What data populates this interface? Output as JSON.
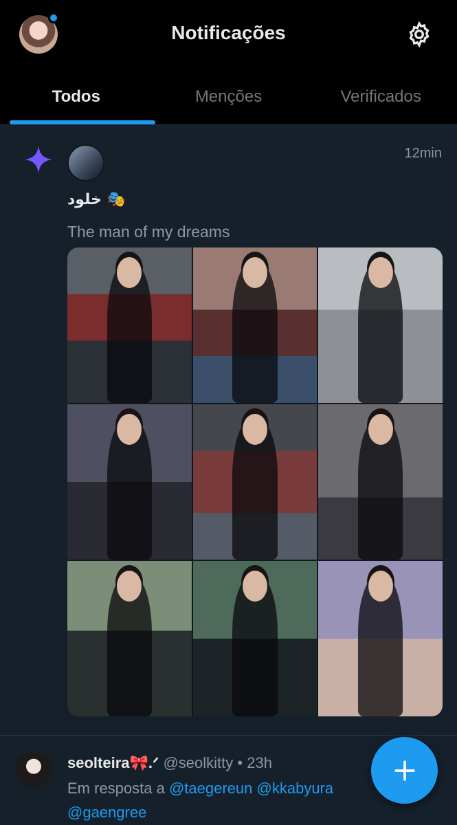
{
  "header": {
    "title": "Notificações"
  },
  "tabs": [
    {
      "label": "Todos",
      "active": true
    },
    {
      "label": "Menções",
      "active": false
    },
    {
      "label": "Verificados",
      "active": false
    }
  ],
  "notification": {
    "time": "12min",
    "user_name": "خلود 🎭",
    "post_text": "The man of my dreams",
    "image_count": 9
  },
  "reply": {
    "display_name": "seolteira🎀.ᐟ",
    "handle": "@seolkitty",
    "separator": "•",
    "time": "23h",
    "reply_prefix": "Em resposta a",
    "mentions": [
      "@taegereun",
      "@kkabyura",
      "@gaengree"
    ]
  },
  "icons": {
    "settings": "gear-icon",
    "notification_type": "sparkle-icon",
    "compose": "plus-icon"
  },
  "colors": {
    "accent": "#1d9bf0",
    "background": "#15202b",
    "sparkle": "#7856ff"
  }
}
